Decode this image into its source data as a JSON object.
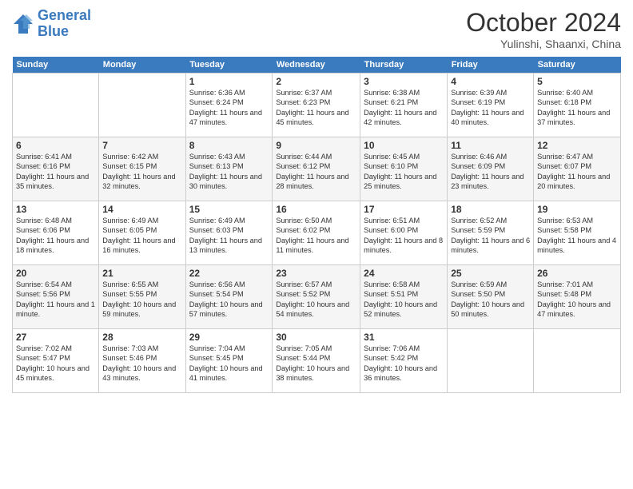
{
  "logo": {
    "line1": "General",
    "line2": "Blue"
  },
  "title": "October 2024",
  "subtitle": "Yulinshi, Shaanxi, China",
  "days_of_week": [
    "Sunday",
    "Monday",
    "Tuesday",
    "Wednesday",
    "Thursday",
    "Friday",
    "Saturday"
  ],
  "weeks": [
    [
      {
        "day": "",
        "info": ""
      },
      {
        "day": "",
        "info": ""
      },
      {
        "day": "1",
        "info": "Sunrise: 6:36 AM\nSunset: 6:24 PM\nDaylight: 11 hours and 47 minutes."
      },
      {
        "day": "2",
        "info": "Sunrise: 6:37 AM\nSunset: 6:23 PM\nDaylight: 11 hours and 45 minutes."
      },
      {
        "day": "3",
        "info": "Sunrise: 6:38 AM\nSunset: 6:21 PM\nDaylight: 11 hours and 42 minutes."
      },
      {
        "day": "4",
        "info": "Sunrise: 6:39 AM\nSunset: 6:19 PM\nDaylight: 11 hours and 40 minutes."
      },
      {
        "day": "5",
        "info": "Sunrise: 6:40 AM\nSunset: 6:18 PM\nDaylight: 11 hours and 37 minutes."
      }
    ],
    [
      {
        "day": "6",
        "info": "Sunrise: 6:41 AM\nSunset: 6:16 PM\nDaylight: 11 hours and 35 minutes."
      },
      {
        "day": "7",
        "info": "Sunrise: 6:42 AM\nSunset: 6:15 PM\nDaylight: 11 hours and 32 minutes."
      },
      {
        "day": "8",
        "info": "Sunrise: 6:43 AM\nSunset: 6:13 PM\nDaylight: 11 hours and 30 minutes."
      },
      {
        "day": "9",
        "info": "Sunrise: 6:44 AM\nSunset: 6:12 PM\nDaylight: 11 hours and 28 minutes."
      },
      {
        "day": "10",
        "info": "Sunrise: 6:45 AM\nSunset: 6:10 PM\nDaylight: 11 hours and 25 minutes."
      },
      {
        "day": "11",
        "info": "Sunrise: 6:46 AM\nSunset: 6:09 PM\nDaylight: 11 hours and 23 minutes."
      },
      {
        "day": "12",
        "info": "Sunrise: 6:47 AM\nSunset: 6:07 PM\nDaylight: 11 hours and 20 minutes."
      }
    ],
    [
      {
        "day": "13",
        "info": "Sunrise: 6:48 AM\nSunset: 6:06 PM\nDaylight: 11 hours and 18 minutes."
      },
      {
        "day": "14",
        "info": "Sunrise: 6:49 AM\nSunset: 6:05 PM\nDaylight: 11 hours and 16 minutes."
      },
      {
        "day": "15",
        "info": "Sunrise: 6:49 AM\nSunset: 6:03 PM\nDaylight: 11 hours and 13 minutes."
      },
      {
        "day": "16",
        "info": "Sunrise: 6:50 AM\nSunset: 6:02 PM\nDaylight: 11 hours and 11 minutes."
      },
      {
        "day": "17",
        "info": "Sunrise: 6:51 AM\nSunset: 6:00 PM\nDaylight: 11 hours and 8 minutes."
      },
      {
        "day": "18",
        "info": "Sunrise: 6:52 AM\nSunset: 5:59 PM\nDaylight: 11 hours and 6 minutes."
      },
      {
        "day": "19",
        "info": "Sunrise: 6:53 AM\nSunset: 5:58 PM\nDaylight: 11 hours and 4 minutes."
      }
    ],
    [
      {
        "day": "20",
        "info": "Sunrise: 6:54 AM\nSunset: 5:56 PM\nDaylight: 11 hours and 1 minute."
      },
      {
        "day": "21",
        "info": "Sunrise: 6:55 AM\nSunset: 5:55 PM\nDaylight: 10 hours and 59 minutes."
      },
      {
        "day": "22",
        "info": "Sunrise: 6:56 AM\nSunset: 5:54 PM\nDaylight: 10 hours and 57 minutes."
      },
      {
        "day": "23",
        "info": "Sunrise: 6:57 AM\nSunset: 5:52 PM\nDaylight: 10 hours and 54 minutes."
      },
      {
        "day": "24",
        "info": "Sunrise: 6:58 AM\nSunset: 5:51 PM\nDaylight: 10 hours and 52 minutes."
      },
      {
        "day": "25",
        "info": "Sunrise: 6:59 AM\nSunset: 5:50 PM\nDaylight: 10 hours and 50 minutes."
      },
      {
        "day": "26",
        "info": "Sunrise: 7:01 AM\nSunset: 5:48 PM\nDaylight: 10 hours and 47 minutes."
      }
    ],
    [
      {
        "day": "27",
        "info": "Sunrise: 7:02 AM\nSunset: 5:47 PM\nDaylight: 10 hours and 45 minutes."
      },
      {
        "day": "28",
        "info": "Sunrise: 7:03 AM\nSunset: 5:46 PM\nDaylight: 10 hours and 43 minutes."
      },
      {
        "day": "29",
        "info": "Sunrise: 7:04 AM\nSunset: 5:45 PM\nDaylight: 10 hours and 41 minutes."
      },
      {
        "day": "30",
        "info": "Sunrise: 7:05 AM\nSunset: 5:44 PM\nDaylight: 10 hours and 38 minutes."
      },
      {
        "day": "31",
        "info": "Sunrise: 7:06 AM\nSunset: 5:42 PM\nDaylight: 10 hours and 36 minutes."
      },
      {
        "day": "",
        "info": ""
      },
      {
        "day": "",
        "info": ""
      }
    ]
  ]
}
